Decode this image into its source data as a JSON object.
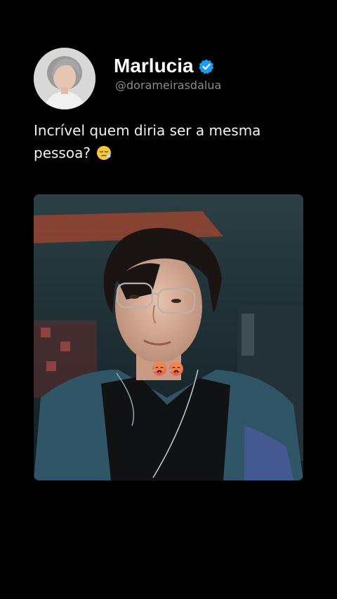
{
  "profile": {
    "display_name": "Marlucia",
    "handle": "@dorameirasdalua",
    "verified": true,
    "verified_color": "#1d9bf0",
    "avatar_icon": "user-avatar"
  },
  "tweet": {
    "line1": "Incrível quem diria ser a mesma",
    "line2": "pessoa?",
    "inline_emoji_icon": "sleepy-face-icon"
  },
  "media": {
    "type": "photo",
    "overlay_emojis": [
      "hot-face-icon",
      "hot-face-icon"
    ]
  },
  "colors": {
    "background": "#000000",
    "text": "#f2f2f2",
    "handle": "#8b8b8b"
  }
}
